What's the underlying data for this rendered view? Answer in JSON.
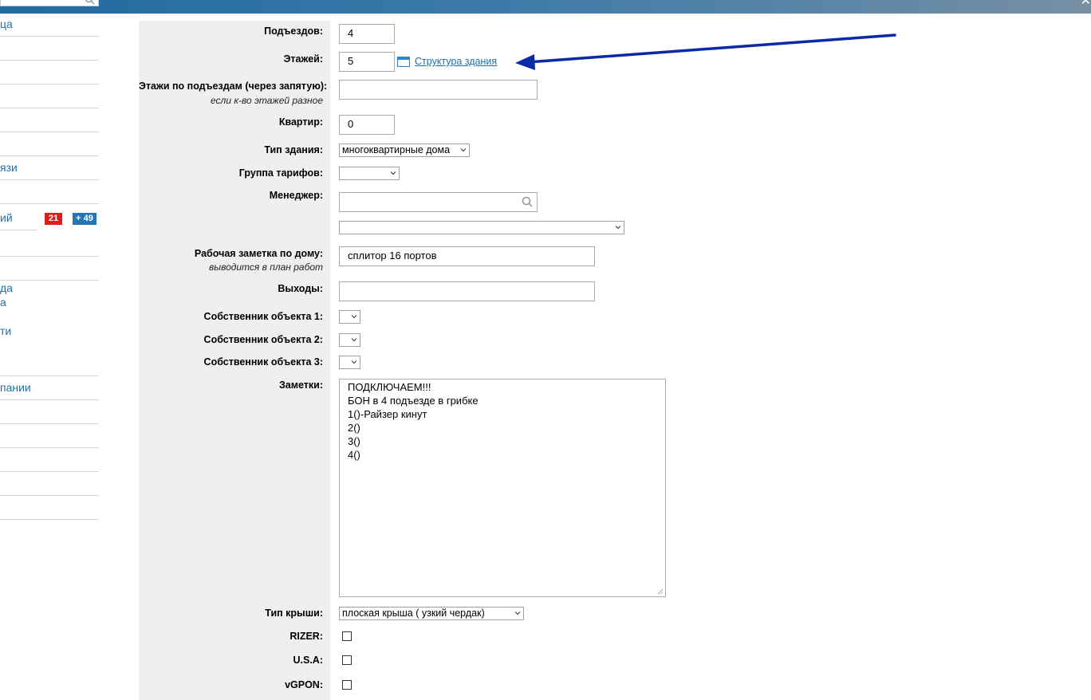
{
  "sidebar": {
    "links": [
      "ца",
      "язи",
      "ий",
      "да",
      "а",
      "ти",
      "пании"
    ],
    "badge_red": "21",
    "badge_blue": "+ 49"
  },
  "form": {
    "entrances": {
      "label": "Подъездов:",
      "value": "4"
    },
    "floors": {
      "label": "Этажей:",
      "value": "5",
      "link": "Структура здания"
    },
    "floors_by_entrance": {
      "label": "Этажи по подъездам (через запятую):",
      "hint": "если к-во этажей разное",
      "value": ""
    },
    "apartments": {
      "label": "Квартир:",
      "value": "0"
    },
    "building_type": {
      "label": "Тип здания:",
      "selected": "многоквартирные дома"
    },
    "tariff_group": {
      "label": "Группа тарифов:",
      "selected": ""
    },
    "manager": {
      "label": "Менеджер:",
      "search_value": "",
      "selected": ""
    },
    "work_note": {
      "label": "Рабочая заметка по дому:",
      "hint": "выводится в план работ",
      "value": "сплитор 16 портов"
    },
    "exits": {
      "label": "Выходы:",
      "value": ""
    },
    "owner1": {
      "label": "Собственник объекта 1:",
      "selected": ""
    },
    "owner2": {
      "label": "Собственник объекта 2:",
      "selected": ""
    },
    "owner3": {
      "label": "Собственник объекта 3:",
      "selected": ""
    },
    "notes": {
      "label": "Заметки:",
      "lines": [
        "ПОДКЛЮЧАЕМ!!!",
        "БОН в 4 подъезде в грибке",
        "1()-Райзер кинут",
        "2()",
        "3()",
        "4()"
      ]
    },
    "roof_type": {
      "label": "Тип крыши:",
      "selected": "плоская крыша ( узкий чердак)"
    },
    "rizer": {
      "label": "RIZER:",
      "checked": false
    },
    "usa": {
      "label": "U.S.A:",
      "checked": false
    },
    "vgpon": {
      "label": "vGPON:",
      "checked": false
    }
  },
  "colors": {
    "accent": "#1e6fa8",
    "arrow": "#0b2aa6",
    "badge_red": "#e01b1b",
    "badge_blue": "#2276b8",
    "label_bg": "#efefef"
  },
  "icons": [
    "search-icon",
    "close-icon",
    "calendar-icon",
    "chevron-down-icon",
    "resize-grip-icon"
  ]
}
